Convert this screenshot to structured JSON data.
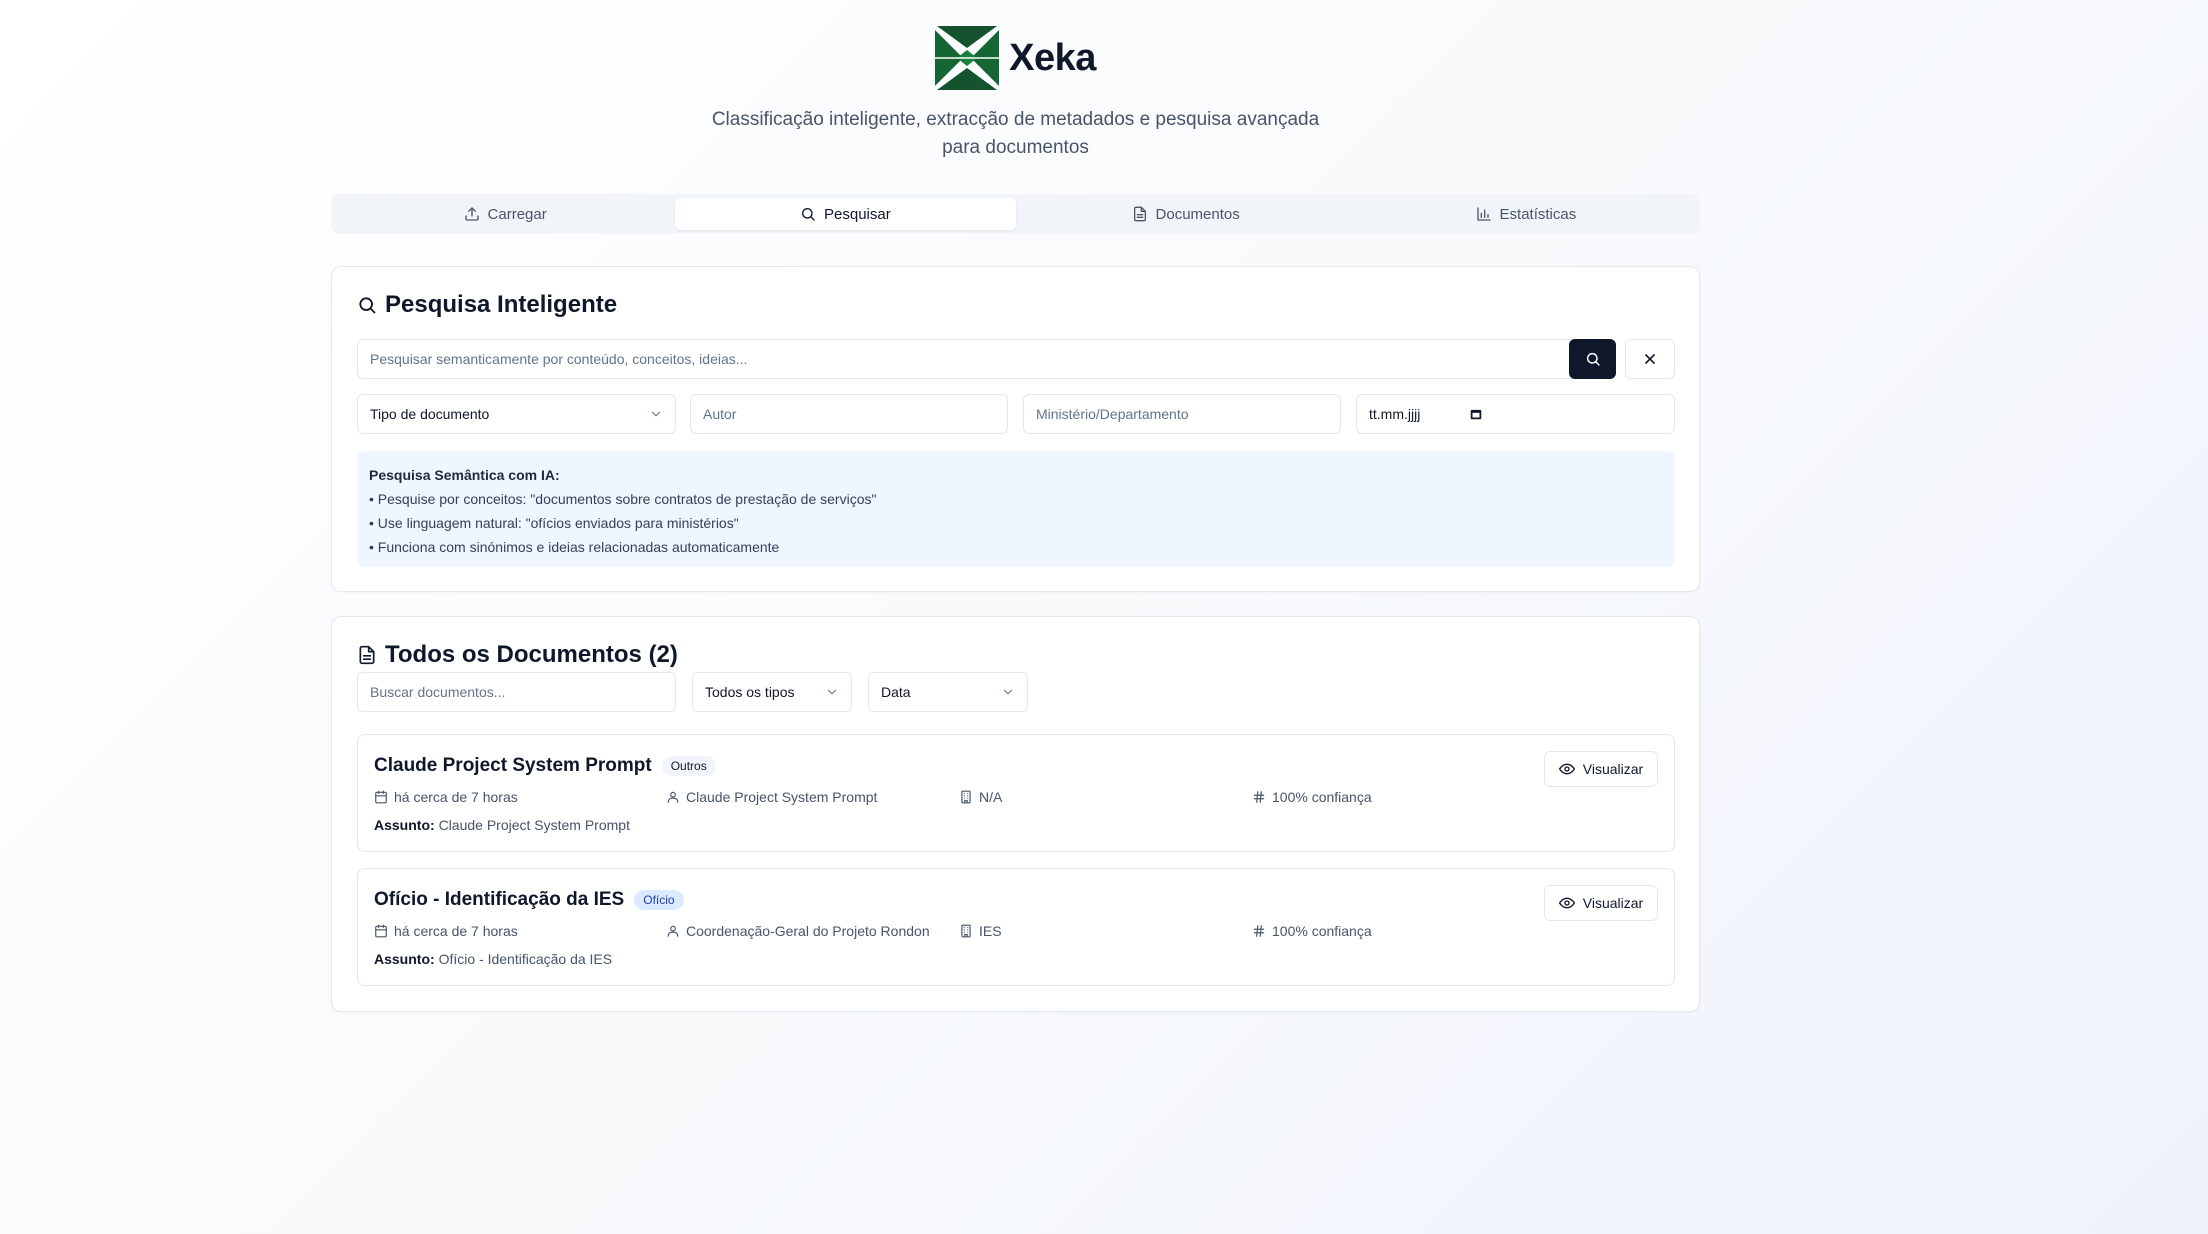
{
  "brand": {
    "name": "Xeka",
    "tagline": "Classificação inteligente, extracção de metadados e pesquisa avançada para documentos",
    "logo_color": "#14532d"
  },
  "tabs": [
    {
      "label": "Carregar",
      "icon": "upload-icon",
      "active": false
    },
    {
      "label": "Pesquisar",
      "icon": "search-icon",
      "active": true
    },
    {
      "label": "Documentos",
      "icon": "file-text-icon",
      "active": false
    },
    {
      "label": "Estatísticas",
      "icon": "bar-chart-icon",
      "active": false
    }
  ],
  "search": {
    "title": "Pesquisa Inteligente",
    "placeholder": "Pesquisar semanticamente por conteúdo, conceitos, ideias...",
    "filters": {
      "doc_type": "Tipo de documento",
      "author_placeholder": "Autor",
      "ministry_placeholder": "Ministério/Departamento",
      "date_placeholder": "tt.mm.jjjj"
    },
    "info": {
      "title": "Pesquisa Semântica com IA:",
      "lines": [
        "• Pesquise por conceitos: \"documentos sobre contratos de prestação de serviços\"",
        "• Use linguagem natural: \"ofícios enviados para ministérios\"",
        "• Funciona com sinónimos e ideias relacionadas automaticamente"
      ]
    }
  },
  "documents": {
    "title": "Todos os Documentos (2)",
    "search_placeholder": "Buscar documentos...",
    "type_filter": "Todos os tipos",
    "sort": "Data",
    "view_label": "Visualizar",
    "subject_label": "Assunto:",
    "items": [
      {
        "title": "Claude Project System Prompt",
        "badge": "Outros",
        "date": "há cerca de 7 horas",
        "author": "Claude Project System Prompt",
        "ministry": "N/A",
        "confidence": "100% confiança",
        "subject": "Claude Project System Prompt"
      },
      {
        "title": "Ofício - Identificação da IES",
        "badge": "Ofício",
        "date": "há cerca de 7 horas",
        "author": "Coordenação-Geral do Projeto Rondon",
        "ministry": "IES",
        "confidence": "100% confiança",
        "subject": "Ofício - Identificação da IES"
      }
    ]
  }
}
